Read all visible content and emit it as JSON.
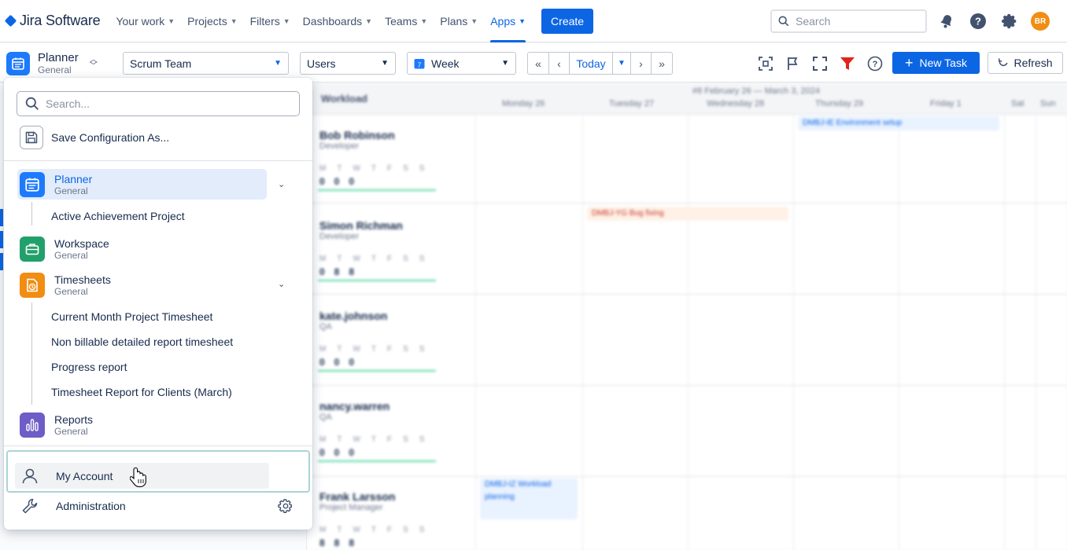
{
  "topnav": {
    "brand": "Jira Software",
    "items": [
      {
        "label": "Your work"
      },
      {
        "label": "Projects"
      },
      {
        "label": "Filters"
      },
      {
        "label": "Dashboards"
      },
      {
        "label": "Teams"
      },
      {
        "label": "Plans"
      },
      {
        "label": "Apps"
      }
    ],
    "create_label": "Create",
    "search_placeholder": "Search",
    "avatar_initials": "BR",
    "accent": "#0c66e4",
    "avatar_color": "#f18d13"
  },
  "toolbar": {
    "app_title": "Planner",
    "app_subtitle": "General",
    "team_select": "Scrum Team",
    "users_select": "Users",
    "view_select": "Week",
    "today_label": "Today",
    "new_task_label": "New Task",
    "refresh_label": "Refresh"
  },
  "background": {
    "workload_label": "Workload",
    "date_range": "#8 February 26 — March 3, 2024",
    "columns": [
      "Monday 26",
      "Tuesday 27",
      "Wednesday 28",
      "Thursday 29",
      "Friday 1",
      "Sat",
      "Sun"
    ],
    "users": [
      {
        "name": "Bob Robinson",
        "role": "Developer",
        "days": "MTWTFSS",
        "values": "000"
      },
      {
        "name": "Simon Richman",
        "role": "Developer",
        "days": "MTWTFSS",
        "values": "088"
      },
      {
        "name": "kate.johnson",
        "role": "QA",
        "days": "MTWTFSS",
        "values": "000"
      },
      {
        "name": "nancy.warren",
        "role": "QA",
        "days": "MTWTFSS",
        "values": "000"
      },
      {
        "name": "Frank Larsson",
        "role": "Project Manager",
        "days": "MTWTFSS",
        "values": "888"
      }
    ],
    "tasks": [
      "DMBJ-IE Environment setup",
      "DMBJ-YG Bug fixing",
      "DMBJ-IZ Workload planning"
    ]
  },
  "menu": {
    "search_placeholder": "Search...",
    "save_config": "Save Configuration As...",
    "apps": [
      {
        "title": "Planner",
        "subtitle": "General",
        "color": "#1d7afc"
      },
      {
        "title": "Workspace",
        "subtitle": "General",
        "color": "#22a06b"
      },
      {
        "title": "Timesheets",
        "subtitle": "General",
        "color": "#f18d13"
      },
      {
        "title": "Reports",
        "subtitle": "General",
        "color": "#6e5dc6"
      }
    ],
    "planner_children": [
      "Active Achievement Project"
    ],
    "timesheet_children": [
      "Current Month Project Timesheet",
      "Non billable detailed report timesheet",
      "Progress report",
      "Timesheet Report for Clients (March)"
    ],
    "my_account": "My Account",
    "administration": "Administration"
  }
}
